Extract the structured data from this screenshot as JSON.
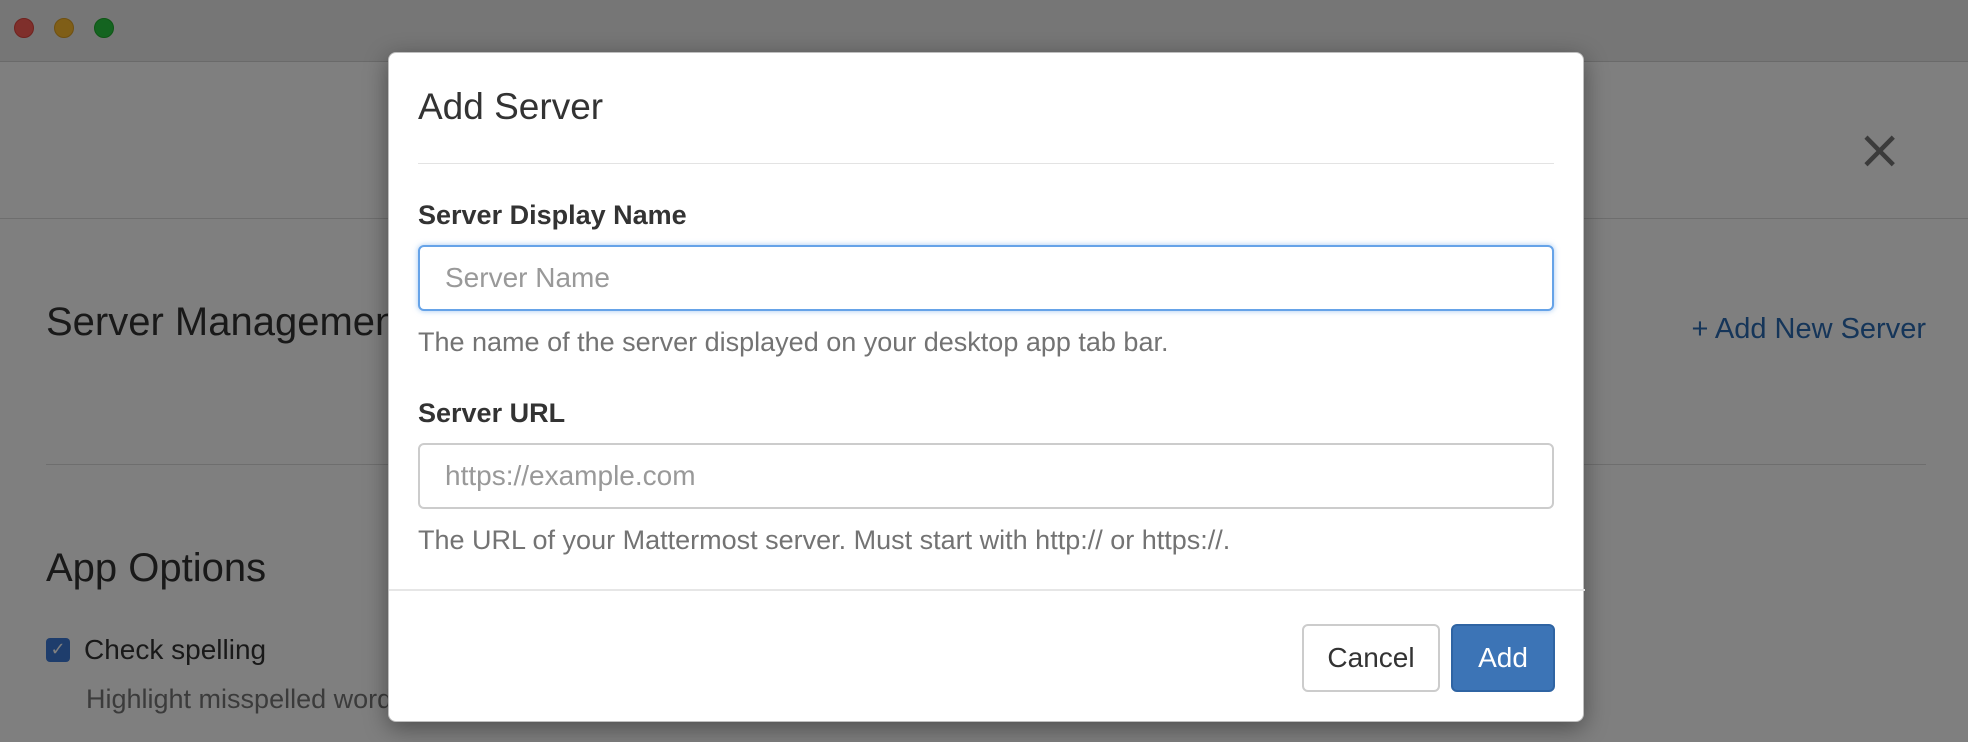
{
  "window": {
    "controls": [
      "close",
      "minimize",
      "maximize"
    ]
  },
  "settings": {
    "close_icon": "×",
    "server_management_title": "Server Management",
    "add_new_server_link": "+ Add New Server",
    "app_options_title": "App Options",
    "check_spelling_label": "Check spelling",
    "check_spelling_checked": true,
    "check_spelling_help": "Highlight misspelled words"
  },
  "modal": {
    "title": "Add Server",
    "server_name": {
      "label": "Server Display Name",
      "placeholder": "Server Name",
      "value": "",
      "help": "The name of the server displayed on your desktop app tab bar."
    },
    "server_url": {
      "label": "Server URL",
      "placeholder": "https://example.com",
      "value": "",
      "help": "The URL of your Mattermost server. Must start with http:// or https://."
    },
    "cancel_label": "Cancel",
    "add_label": "Add"
  },
  "colors": {
    "primary_button": "#3c74b6",
    "link": "#2a6bb3",
    "focus_border": "#66a3e8"
  }
}
